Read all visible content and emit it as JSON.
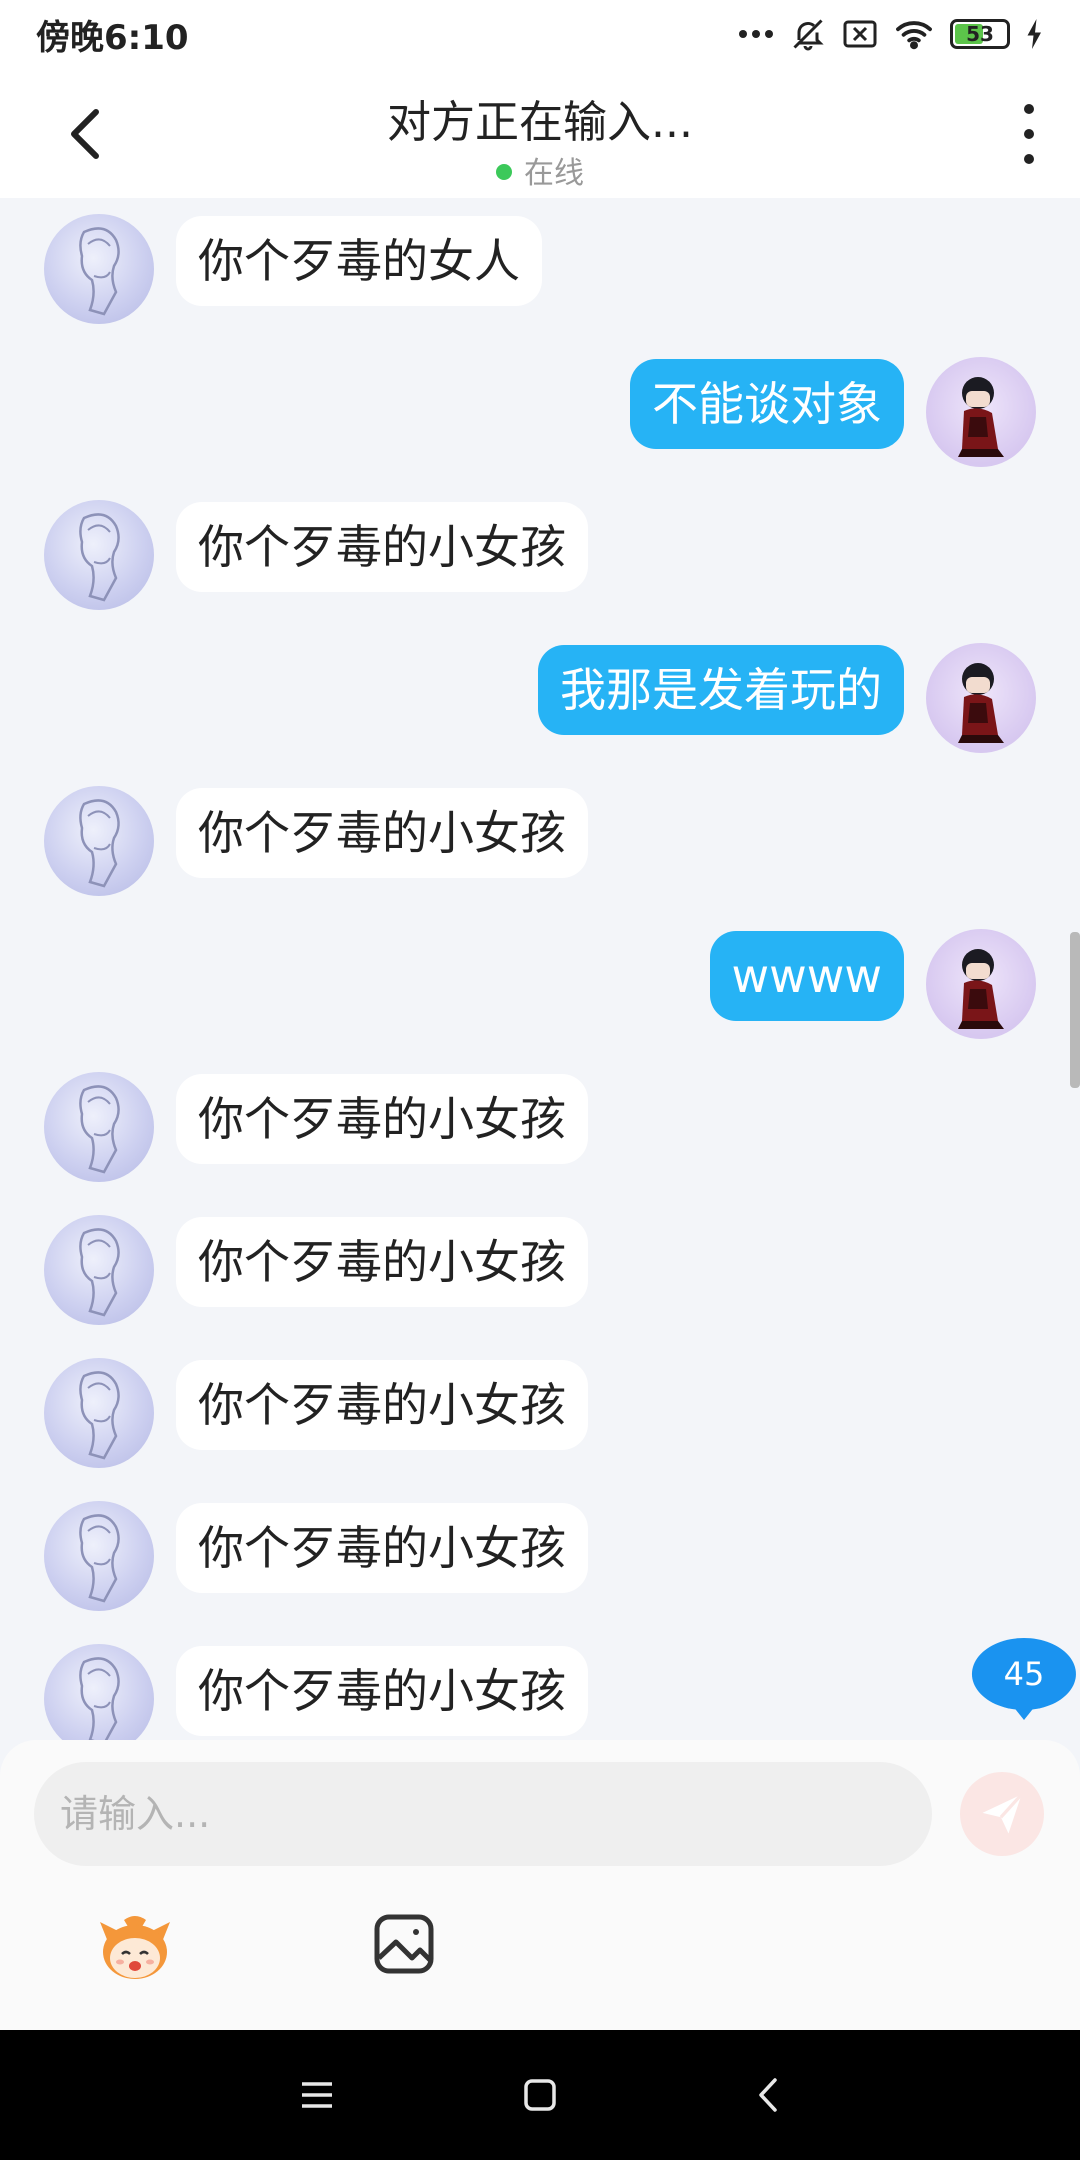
{
  "status_bar": {
    "time": "傍晚6:10",
    "battery": "53"
  },
  "header": {
    "title": "对方正在输入...",
    "presence": "在线"
  },
  "messages": [
    {
      "side": "in",
      "text": "你个歹毒的女人"
    },
    {
      "side": "out",
      "text": "不能谈对象"
    },
    {
      "side": "in",
      "text": "你个歹毒的小女孩"
    },
    {
      "side": "out",
      "text": "我那是发着玩的"
    },
    {
      "side": "in",
      "text": "你个歹毒的小女孩"
    },
    {
      "side": "out",
      "text": "wwww"
    },
    {
      "side": "in",
      "text": "你个歹毒的小女孩"
    },
    {
      "side": "in",
      "text": "你个歹毒的小女孩"
    },
    {
      "side": "in",
      "text": "你个歹毒的小女孩"
    },
    {
      "side": "in",
      "text": "你个歹毒的小女孩"
    },
    {
      "side": "in",
      "text": "你个歹毒的小女孩"
    }
  ],
  "unread_count": "45",
  "composer": {
    "placeholder": "请输入..."
  },
  "icons": {
    "back": "chevron-left-icon",
    "more": "more-vertical-icon",
    "send": "send-icon",
    "emoji": "emoji-mascot-icon",
    "image": "image-icon"
  },
  "colors": {
    "outgoing_bubble": "#26b3f5",
    "incoming_bubble": "#ffffff",
    "online": "#3cc95a",
    "badge": "#1a93f0"
  }
}
